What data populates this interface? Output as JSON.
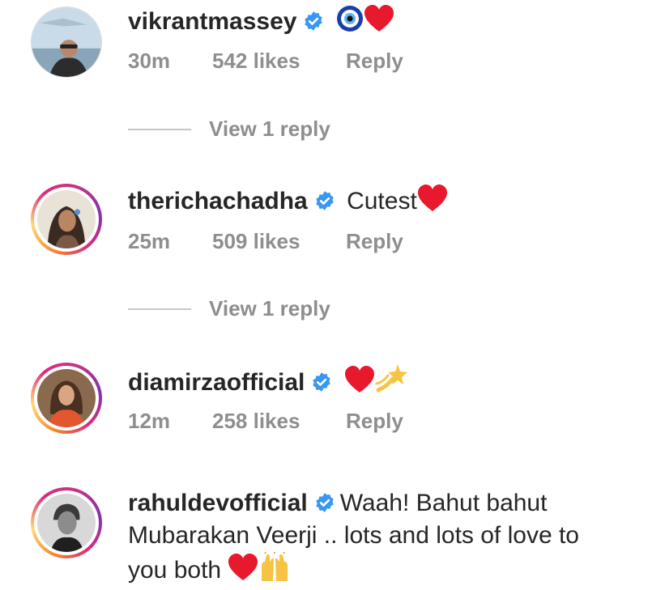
{
  "comments": [
    {
      "username": "vikrantmassey",
      "text": "",
      "time": "30m",
      "likes": "542 likes",
      "reply": "Reply",
      "view_replies": "View 1 reply",
      "emojis": [
        "nazar-amulet",
        "red-heart"
      ]
    },
    {
      "username": "therichachadha",
      "text": "Cutest",
      "time": "25m",
      "likes": "509 likes",
      "reply": "Reply",
      "view_replies": "View 1 reply",
      "emojis": [
        "red-heart"
      ]
    },
    {
      "username": "diamirzaofficial",
      "text": "",
      "time": "12m",
      "likes": "258 likes",
      "reply": "Reply",
      "emojis": [
        "red-heart",
        "dizzy"
      ]
    },
    {
      "username": "rahuldevofficial",
      "text_line1": "Waah! Bahut bahut",
      "text_line2": "Mubarakan Veerji .. lots and lots of love to",
      "text_line3": "you both",
      "emojis": [
        "red-heart",
        "raising-hands"
      ]
    }
  ],
  "colors": {
    "verified": "#3897f0",
    "meta_text": "#8e8e8e",
    "heart": "#e8192c"
  }
}
